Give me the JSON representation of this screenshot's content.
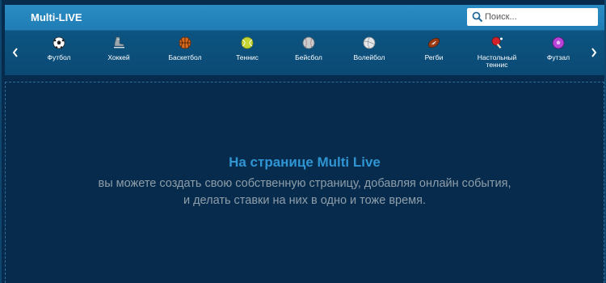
{
  "header": {
    "title": "Multi-LIVE",
    "search_placeholder": "Поиск..."
  },
  "sports": [
    {
      "label": "Футбол",
      "icon": "soccer-ball-icon"
    },
    {
      "label": "Хоккей",
      "icon": "hockey-skate-icon"
    },
    {
      "label": "Баскетбол",
      "icon": "basketball-icon"
    },
    {
      "label": "Теннис",
      "icon": "tennis-ball-icon"
    },
    {
      "label": "Бейсбол",
      "icon": "baseball-icon"
    },
    {
      "label": "Волейбол",
      "icon": "volleyball-icon"
    },
    {
      "label": "Регби",
      "icon": "rugby-ball-icon"
    },
    {
      "label": "Настольный теннис",
      "icon": "table-tennis-icon"
    },
    {
      "label": "Футзал",
      "icon": "futsal-icon"
    }
  ],
  "nav": {
    "prev_icon": "chevron-left-icon",
    "next_icon": "chevron-right-icon"
  },
  "main": {
    "heading": "На странице Multi Live",
    "line1": "вы можете создать свою собственную страницу, добавляя онлайн события,",
    "line2": "и делать ставки на них в одно и тоже время."
  },
  "colors": {
    "background": "#062b4d",
    "header": "#2287c0",
    "accent": "#2f95d3",
    "muted_text": "#8f9ea9"
  }
}
